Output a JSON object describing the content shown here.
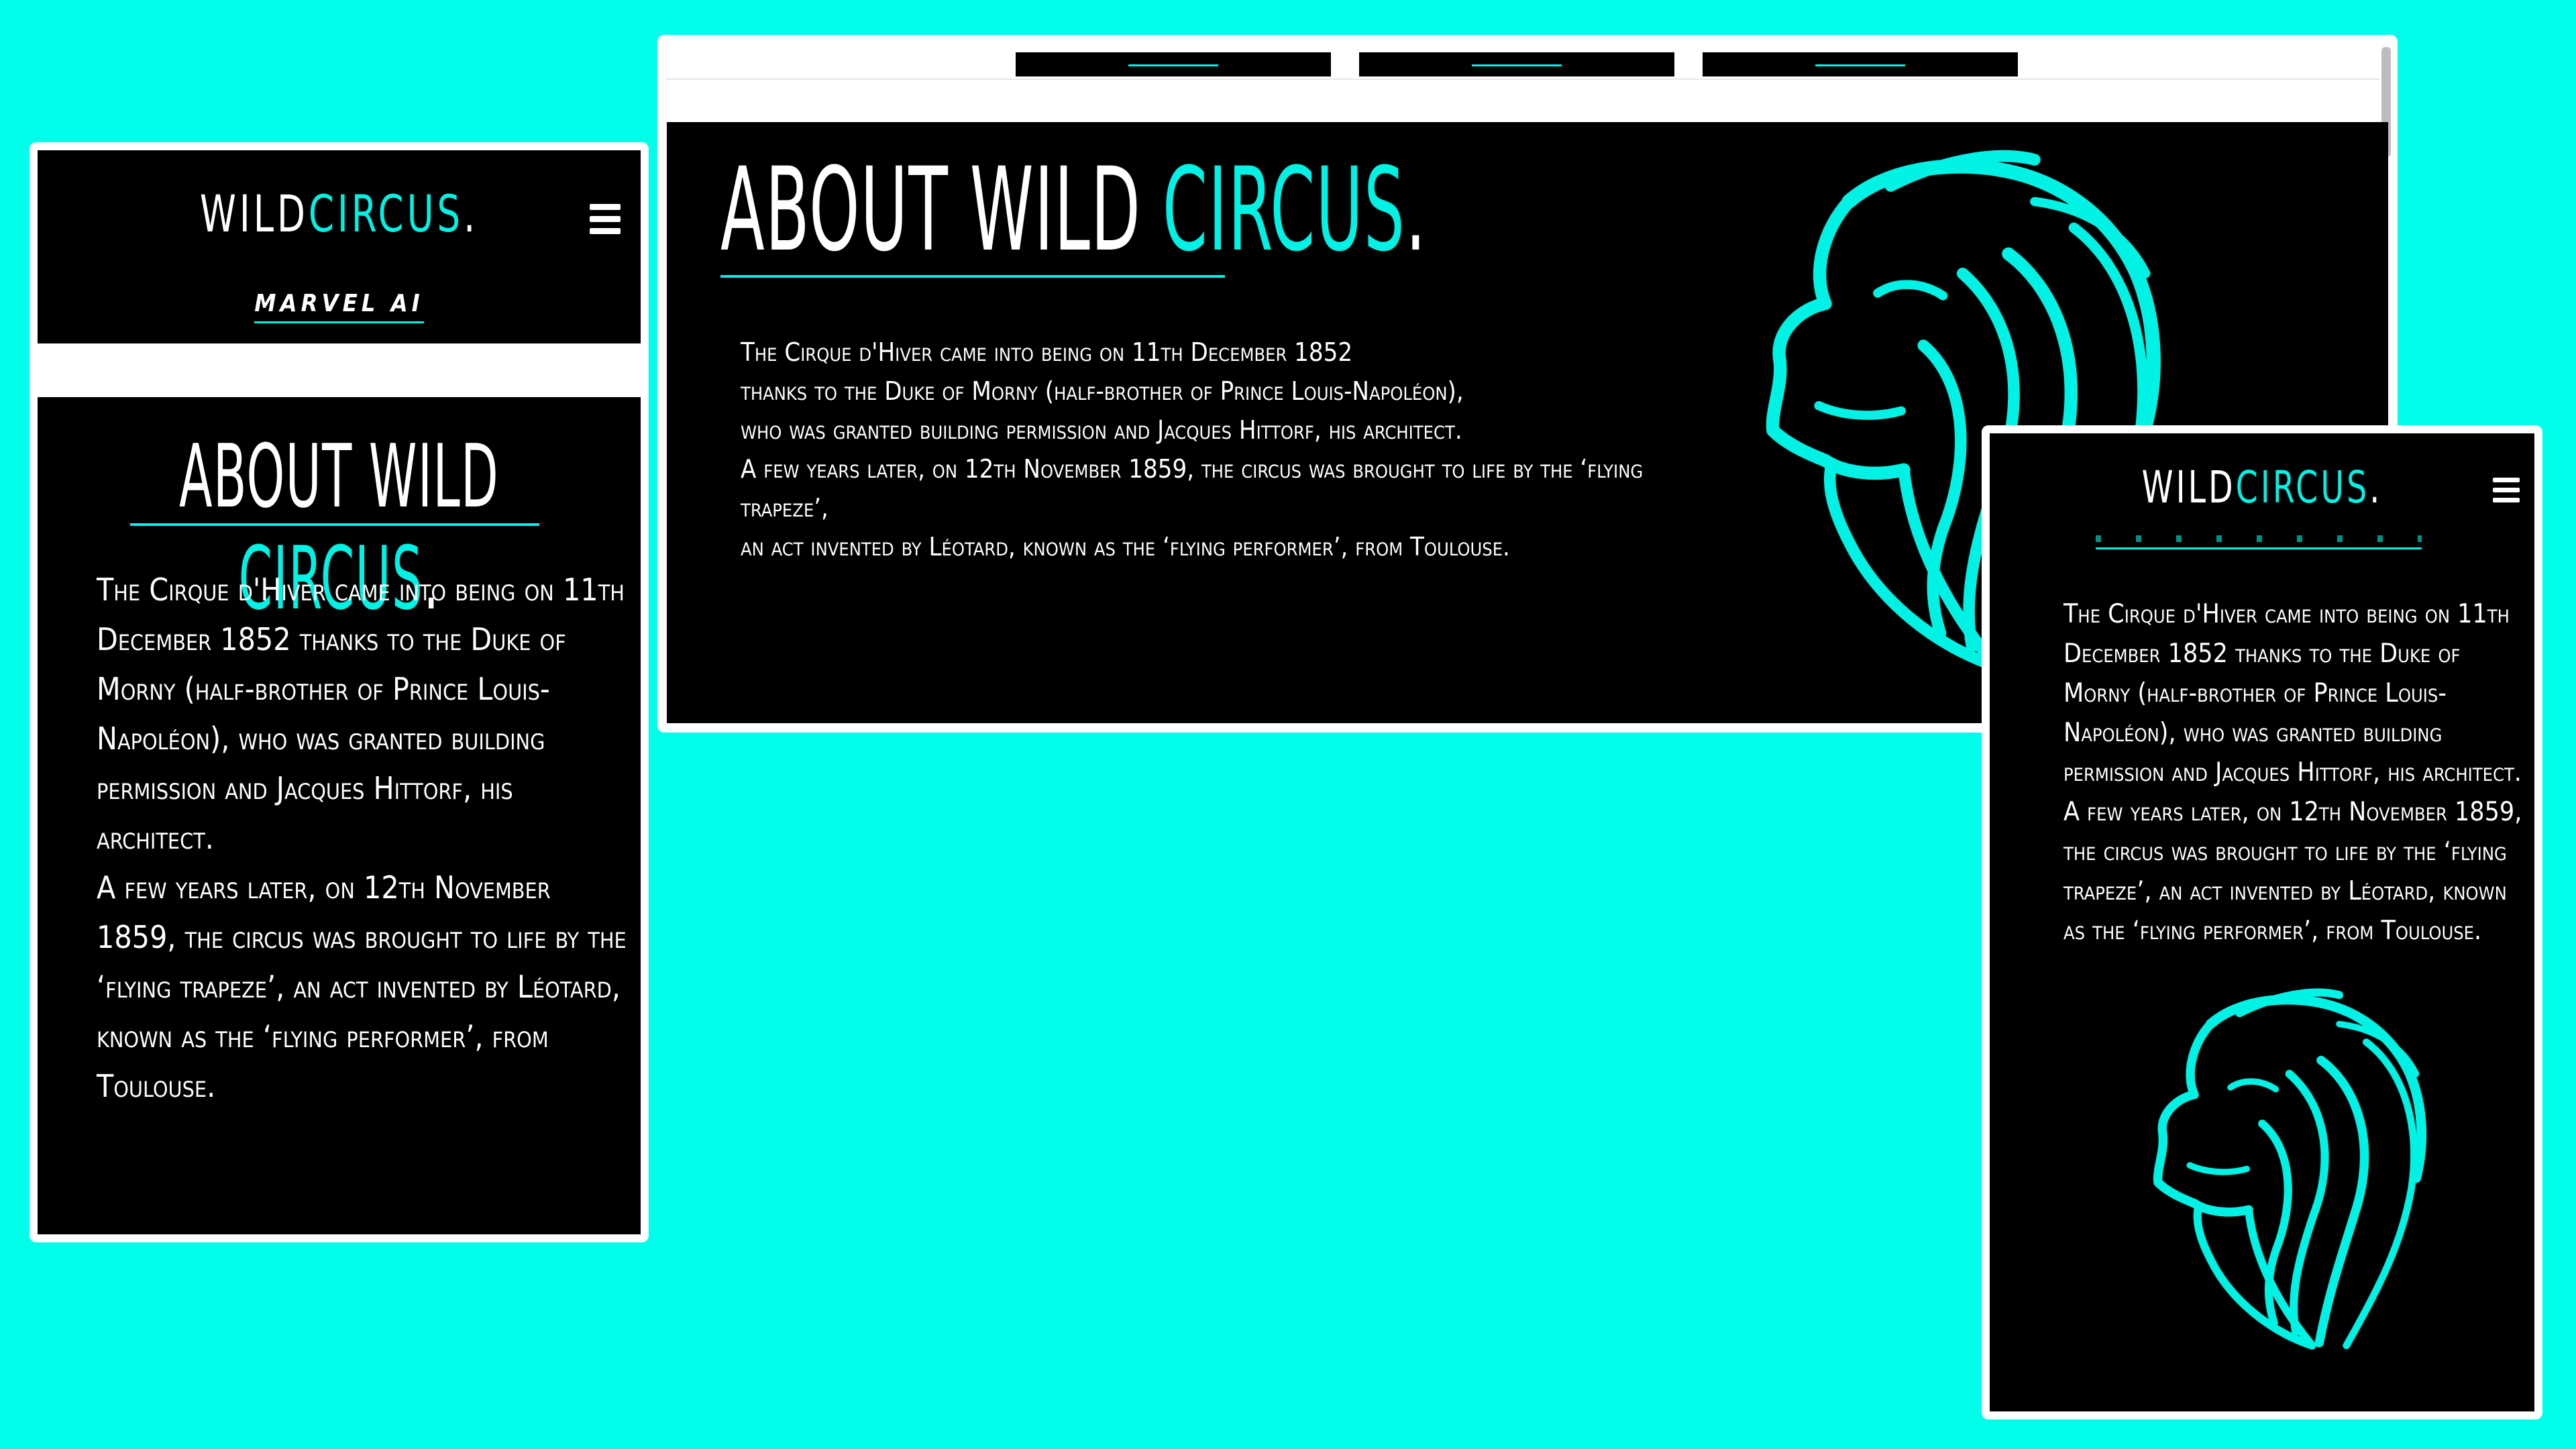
{
  "colors": {
    "background": "#00ffea",
    "accent": "#00f2e5",
    "screen": "#000000",
    "text": "#ffffff"
  },
  "brand": {
    "part1": "WILD",
    "part2": "CIRCUS",
    "dot": "."
  },
  "nav": {
    "mobile_link": "MARVEL AI"
  },
  "about": {
    "title_white": "ABOUT WILD ",
    "title_accent": "CIRCUS",
    "title_dot": ".",
    "lines": [
      "The Cirque d'Hiver came into being on 11th December 1852",
      "thanks to the Duke of Morny (half-brother of Prince Louis-Napoléon),",
      "who was granted building permission and Jacques Hittorf, his architect.",
      "A few years later, on 12th November 1859, the circus was brought to life by the ‘flying trapeze’,",
      "an act invented by Léotard, known as the ‘flying performer’, from Toulouse."
    ],
    "mobile_paragraph_1": "The Cirque d'Hiver came into being on 11th December 1852 thanks to the Duke of Morny (half-brother of Prince Louis-Napoléon), who was granted building permission and Jacques Hittorf, his architect.",
    "mobile_paragraph_2": "A few years later, on 12th November 1859, the circus was brought to life by the ‘flying trapeze’, an act invented by Léotard, known as the ‘flying performer’, from Toulouse."
  },
  "icons": {
    "menu": "hamburger-menu-icon",
    "lion": "lion-head-logo"
  }
}
